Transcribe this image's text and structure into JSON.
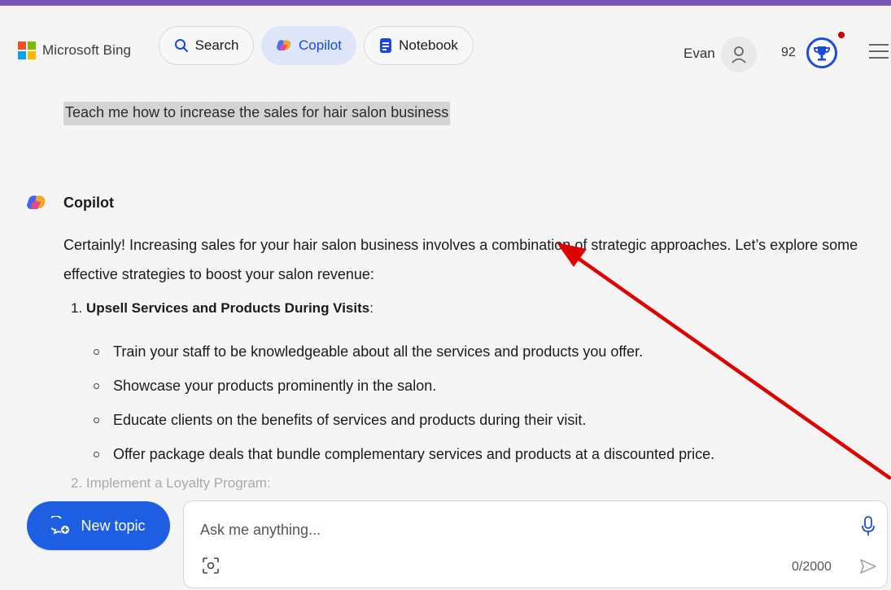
{
  "header": {
    "brand": "Microsoft Bing",
    "nav": [
      {
        "label": "Search"
      },
      {
        "label": "Copilot"
      },
      {
        "label": "Notebook"
      }
    ],
    "user_name": "Evan",
    "points": "92"
  },
  "conversation": {
    "user_message": "Teach me how to increase the sales for hair salon business",
    "assistant_name": "Copilot",
    "intro": "Certainly! Increasing sales for your hair salon business involves a combination of strategic approaches. Let’s explore some effective strategies to boost your salon revenue:",
    "sections": [
      {
        "number": "1.",
        "title": "Upsell Services and Products During Visits",
        "suffix": ":",
        "bullets": [
          "Train your staff to be knowledgeable about all the services and products you offer.",
          "Showcase your products prominently in the salon.",
          "Educate clients on the benefits of services and products during their visit.",
          "Offer package deals that bundle complementary services and products at a discounted price."
        ]
      }
    ],
    "next_item_faded": "2. Implement a Loyalty Program:"
  },
  "composer": {
    "new_topic_label": "New topic",
    "placeholder": "Ask me anything...",
    "counter": "0/2000"
  },
  "colors": {
    "accent": "#1d5ee3",
    "annotation_arrow": "#e00000",
    "top_strip": "#7b52b6"
  }
}
